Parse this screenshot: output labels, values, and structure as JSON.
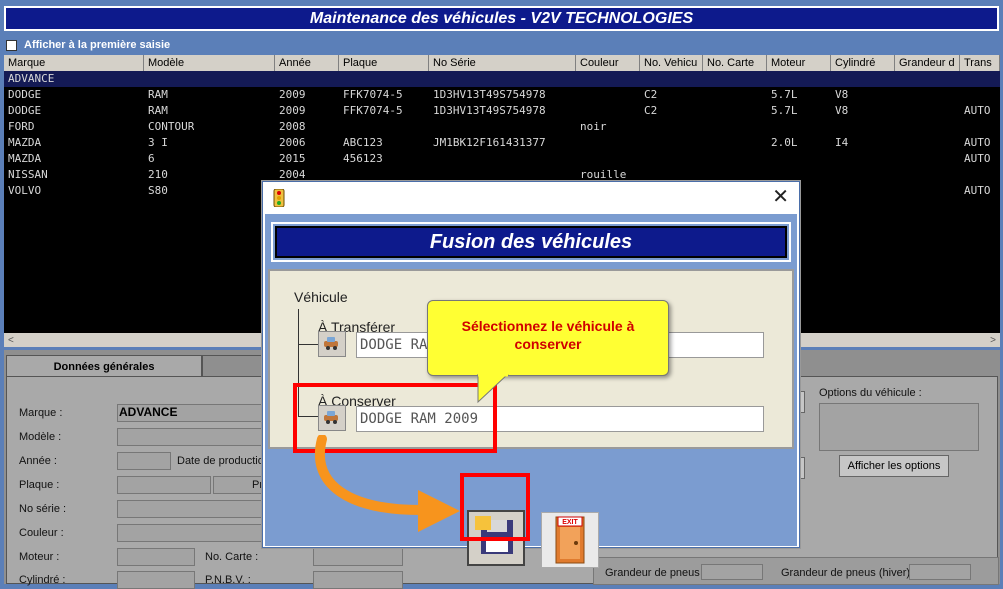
{
  "window": {
    "title": "Maintenance des véhicules - V2V TECHNOLOGIES"
  },
  "options": {
    "first_entry_label": "Afficher à la première saisie"
  },
  "grid": {
    "columns": [
      "Marque",
      "Modèle",
      "Année",
      "Plaque",
      "No Série",
      "Couleur",
      "No. Vehicu",
      "No. Carte",
      "Moteur",
      "Cylindré",
      "Grandeur d",
      "Trans"
    ],
    "rows": [
      [
        "ADVANCE",
        "",
        "",
        "",
        "",
        "",
        "",
        "",
        "",
        "",
        "",
        ""
      ],
      [
        "DODGE",
        "RAM",
        "2009",
        "FFK7074-5",
        "1D3HV13T49S754978",
        "",
        "C2",
        "",
        "5.7L",
        "V8",
        "",
        ""
      ],
      [
        "DODGE",
        "RAM",
        "2009",
        "FFK7074-5",
        "1D3HV13T49S754978",
        "",
        "C2",
        "",
        "5.7L",
        "V8",
        "",
        "AUTO"
      ],
      [
        "FORD",
        "CONTOUR",
        "2008",
        "",
        "",
        "noir",
        "",
        "",
        "",
        "",
        "",
        ""
      ],
      [
        "MAZDA",
        "3 I",
        "2006",
        "ABC123",
        "JM1BK12F161431377",
        "",
        "",
        "",
        "2.0L",
        "I4",
        "",
        "AUTO"
      ],
      [
        "MAZDA",
        "6",
        "2015",
        "456123",
        "",
        "",
        "",
        "",
        "",
        "",
        "",
        "AUTO"
      ],
      [
        "NISSAN",
        "210",
        "2004",
        "",
        "",
        "rouille",
        "",
        "",
        "",
        "",
        "",
        ""
      ],
      [
        "VOLVO",
        "S80",
        "",
        "",
        "",
        "",
        "",
        "",
        "",
        "",
        "",
        "AUTO"
      ]
    ]
  },
  "tabs": {
    "general": "Données générales"
  },
  "form": {
    "marque_label": "Marque :",
    "marque_value": "ADVANCE",
    "modele_label": "Modèle :",
    "annee_label": "Année :",
    "date_prod_label": "Date de production",
    "plaque_label": "Plaque :",
    "pr_label": "Pr",
    "noserie_label": "No série :",
    "couleur_label": "Couleur :",
    "moteur_label": "Moteur :",
    "nocarte_label": "No. Carte :",
    "cylindre_label": "Cylindré :",
    "pnbv_label": "P.N.B.V. :",
    "options_label": "Options du véhicule :",
    "show_options_btn": "Afficher les options",
    "tire_size_label": "Grandeur de pneus",
    "tire_size_winter_label": "Grandeur de pneus (hiver)"
  },
  "dialog": {
    "close_glyph": "✕",
    "banner": "Fusion des véhicules",
    "group_label": "Véhicule",
    "transfer_label": "À Transférer",
    "transfer_value": "DODGE RA",
    "keep_label": "À Conserver",
    "keep_value": "DODGE RAM 2009",
    "exit_text": "EXIT"
  },
  "callout": {
    "text": "Sélectionnez le véhicule à conserver"
  },
  "colors": {
    "accent": "#0d1a8c",
    "background": "#5b7fb8",
    "highlight": "#ff0000",
    "callout": "#ffff33",
    "arrow": "#f7941d"
  }
}
